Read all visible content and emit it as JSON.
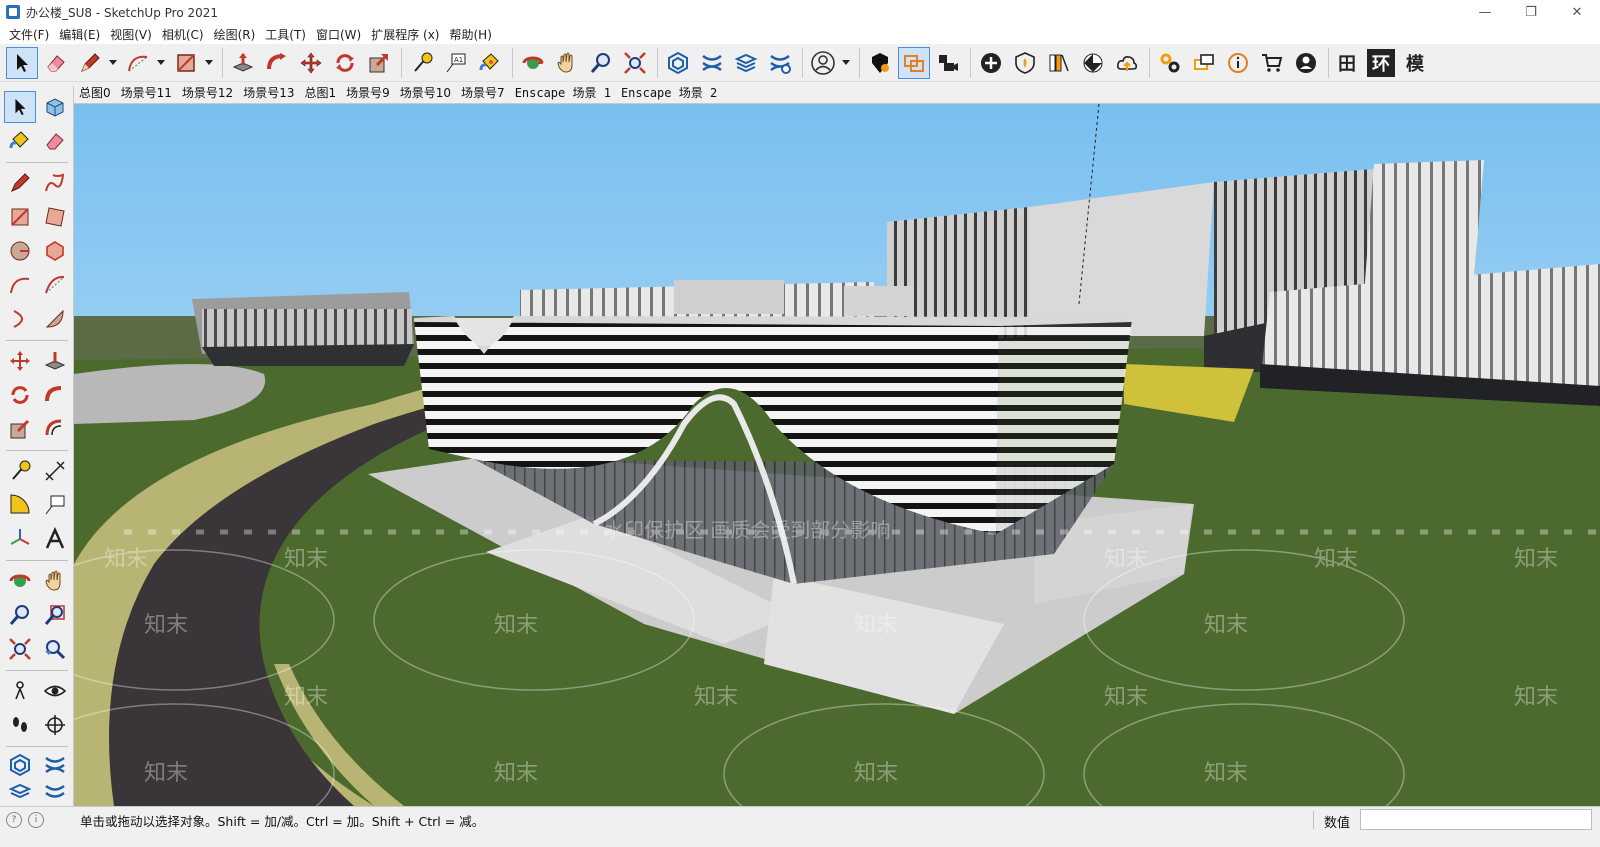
{
  "window": {
    "title": "办公楼_SU8 - SketchUp Pro 2021",
    "controls": {
      "minimize": "—",
      "maximize": "❐",
      "close": "✕"
    }
  },
  "menu": [
    {
      "label": "文件(F)"
    },
    {
      "label": "编辑(E)"
    },
    {
      "label": "视图(V)"
    },
    {
      "label": "相机(C)"
    },
    {
      "label": "绘图(R)"
    },
    {
      "label": "工具(T)"
    },
    {
      "label": "窗口(W)"
    },
    {
      "label": "扩展程序 (x)"
    },
    {
      "label": "帮助(H)"
    }
  ],
  "toolbar": {
    "text_buttons": {
      "grid": "田",
      "env": "环",
      "model": "模"
    }
  },
  "scenes": [
    {
      "label": "总图0"
    },
    {
      "label": "场景号11"
    },
    {
      "label": "场景号12"
    },
    {
      "label": "场景号13"
    },
    {
      "label": "总图1"
    },
    {
      "label": "场景号9"
    },
    {
      "label": "场景号10"
    },
    {
      "label": "场景号7"
    },
    {
      "label": "Enscape 场景 1"
    },
    {
      "label": "Enscape 场景 2"
    }
  ],
  "watermark": {
    "brand": "知末",
    "notice": "水印保护区  画质会受到部分影响"
  },
  "statusbar": {
    "message": "单击或拖动以选择对象。Shift = 加/减。Ctrl = 加。Shift + Ctrl = 减。",
    "value_label": "数值",
    "value": ""
  },
  "colors": {
    "sky_top": "#78bff0",
    "sky_bottom": "#d6ecf8",
    "grass": "#4c6a2e",
    "road": "#3a3538",
    "road_edge": "#b8b574",
    "accent": "#4d8fd8"
  }
}
